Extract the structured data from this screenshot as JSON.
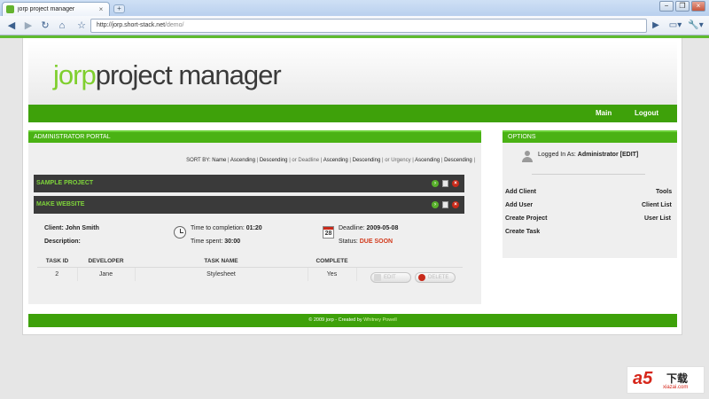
{
  "browser": {
    "tab_title": "jorp project manager",
    "tab_close": "×",
    "new_tab": "+",
    "window_buttons": [
      "−",
      "❐",
      "×"
    ],
    "nav_icons": [
      "back-icon",
      "forward-icon",
      "reload-icon",
      "home-icon",
      "star-icon"
    ],
    "nav_glyphs": [
      "◀",
      "▶",
      "↻",
      "⌂",
      "☆"
    ],
    "url_host": "http://jorp.short-stack.net",
    "url_path": "/demo/",
    "go_glyph": "▶",
    "page_menu_glyph": "▭▾",
    "tools_menu_glyph": "🔧▾"
  },
  "logo": {
    "part1": "jorp",
    "part2": "project manager"
  },
  "nav": {
    "main": "Main",
    "logout": "Logout"
  },
  "admin": {
    "title": "ADMINISTRATOR PORTAL",
    "sort": {
      "label": "SORT BY:",
      "name": "Name",
      "sep": "|",
      "asc": "Ascending",
      "desc": "Descending",
      "or_deadline": "or Deadline",
      "or_urgency": "or Urgency"
    },
    "projects": [
      {
        "name": "SAMPLE PROJECT"
      },
      {
        "name": "MAKE WEBSITE"
      }
    ],
    "detail": {
      "client_label": "Client:",
      "client_value": "John Smith",
      "description_label": "Description:",
      "completion_label": "Time to completion:",
      "completion_value": "01:20",
      "spent_label": "Time spent:",
      "spent_value": "30:00",
      "deadline_label": "Deadline:",
      "deadline_value": "2009-05-08",
      "status_label": "Status:",
      "status_value": "DUE SOON",
      "calendar_day": "28"
    },
    "table": {
      "headers": [
        "TASK ID",
        "DEVELOPER",
        "TASK NAME",
        "COMPLETE"
      ],
      "rows": [
        {
          "id": "2",
          "developer": "Jane",
          "task": "Stylesheet",
          "complete": "Yes"
        }
      ],
      "edit_label": "EDIT",
      "delete_label": "DELETE"
    }
  },
  "options": {
    "title": "OPTIONS",
    "logged_label": "Logged In As:",
    "logged_user": "Administrator",
    "edit_link": "[EDIT]",
    "links_left": [
      "Add Client",
      "Add User",
      "Create Project",
      "Create Task"
    ],
    "links_right": [
      "Tools",
      "Client List",
      "User List"
    ]
  },
  "footer": {
    "text": "© 2009 jorp - Created by",
    "author": "Whitney Powell"
  },
  "watermark": {
    "brand": "a5",
    "cn": "下载",
    "url": "xiazai.com"
  },
  "colors": {
    "accent_green": "#3ea10a",
    "logo_green": "#7fcf2e",
    "due_red": "#d23a1c"
  }
}
